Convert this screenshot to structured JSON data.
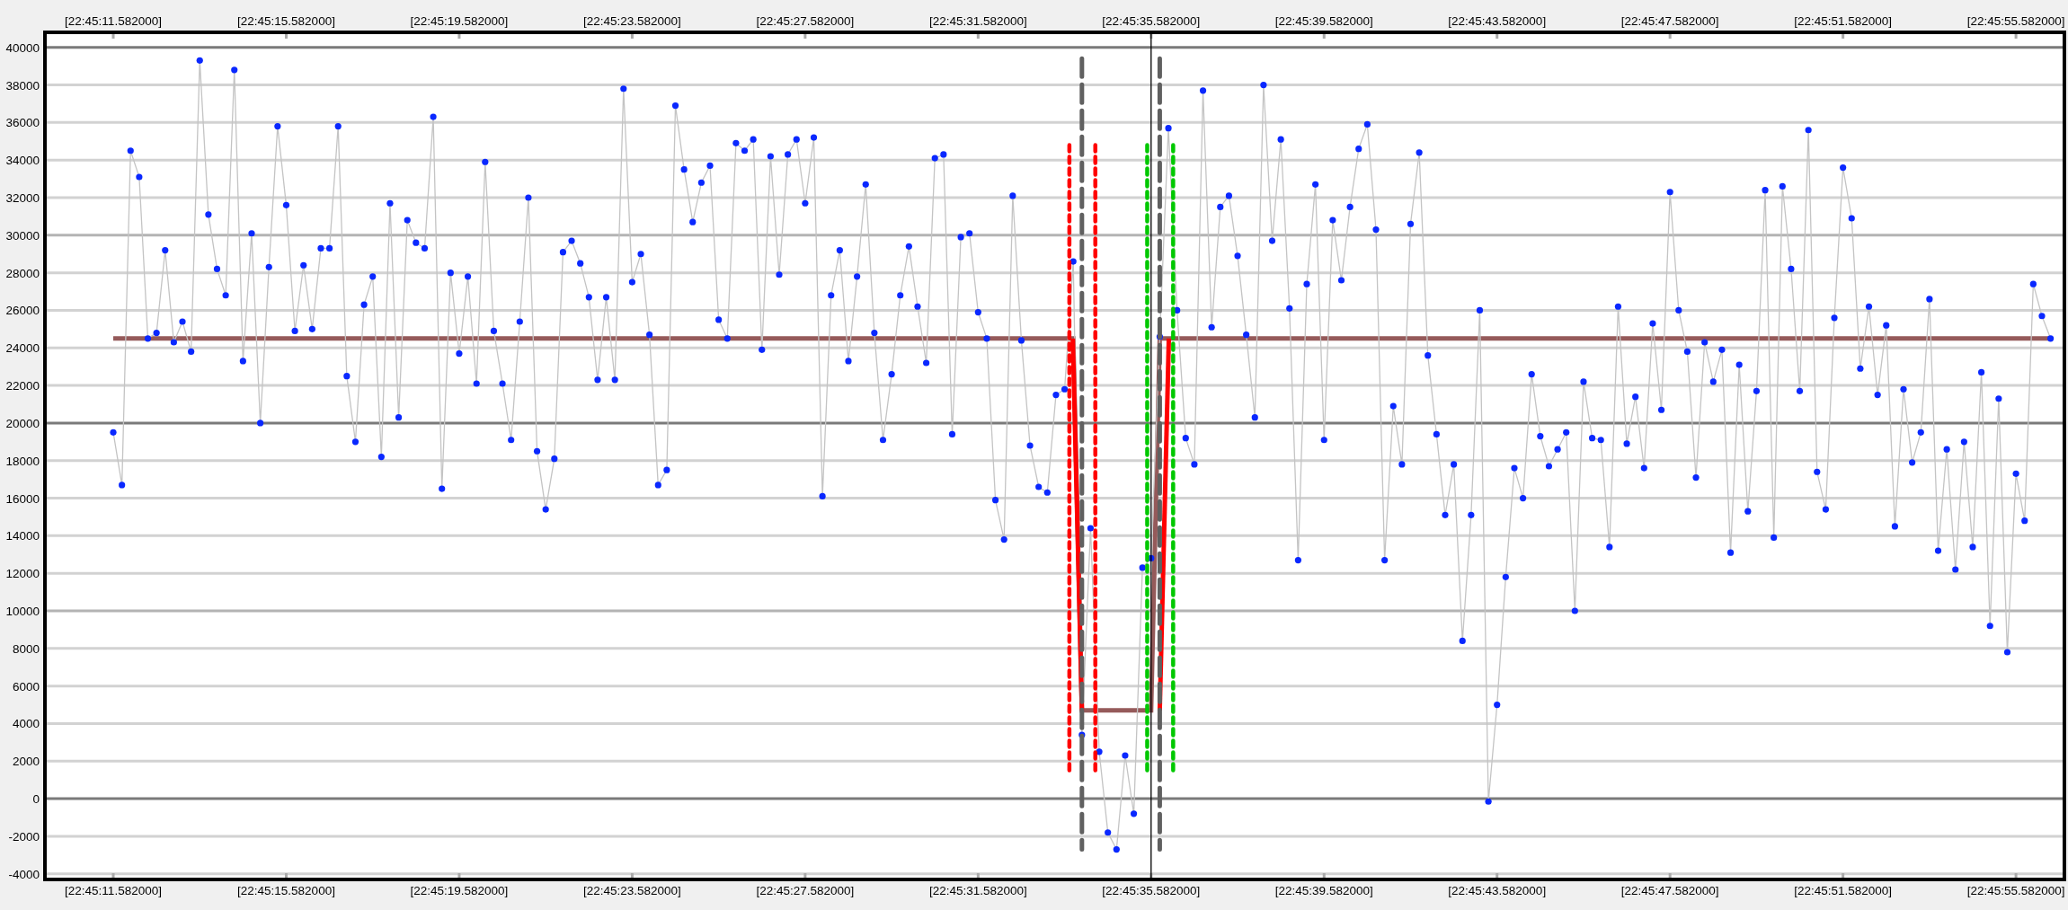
{
  "chart": {
    "chart_data": {
      "type": "line",
      "categories": [
        "[22:45:11.582000]",
        null,
        null,
        null,
        null,
        null,
        null,
        null,
        null,
        null,
        null,
        null,
        null,
        null,
        null,
        null,
        null,
        null,
        null,
        null,
        "[22:45:15.582000]",
        null,
        null,
        null,
        null,
        null,
        null,
        null,
        null,
        null,
        null,
        null,
        null,
        null,
        null,
        null,
        null,
        null,
        null,
        null,
        "[22:45:19.582000]",
        null,
        null,
        null,
        null,
        null,
        null,
        null,
        null,
        null,
        null,
        null,
        null,
        null,
        null,
        null,
        null,
        null,
        null,
        null,
        "[22:45:23.582000]",
        null,
        null,
        null,
        null,
        null,
        null,
        null,
        null,
        null,
        null,
        null,
        null,
        null,
        null,
        null,
        null,
        null,
        null,
        null,
        "[22:45:27.582000]",
        null,
        null,
        null,
        null,
        null,
        null,
        null,
        null,
        null,
        null,
        null,
        null,
        null,
        null,
        null,
        null,
        null,
        null,
        null,
        "[22:45:31.582000]",
        null,
        null,
        null,
        null,
        null,
        null,
        null,
        null,
        null,
        null,
        null,
        null,
        null,
        null,
        null,
        null,
        null,
        null,
        null,
        "[22:45:35.582000]",
        null,
        null,
        null,
        null,
        null,
        null,
        null,
        null,
        null,
        null,
        null,
        null,
        null,
        null,
        null,
        null,
        null,
        null,
        null,
        "[22:45:39.582000]",
        null,
        null,
        null,
        null,
        null,
        null,
        null,
        null,
        null,
        null,
        null,
        null,
        null,
        null,
        null,
        null,
        null,
        null,
        null,
        "[22:45:43.582000]",
        null,
        null,
        null,
        null,
        null,
        null,
        null,
        null,
        null,
        null,
        null,
        null,
        null,
        null,
        null,
        null,
        null,
        null,
        null,
        "[22:45:47.582000]",
        null,
        null,
        null,
        null,
        null,
        null,
        null,
        null,
        null,
        null,
        null,
        null,
        null,
        null,
        null,
        null,
        null,
        null,
        null,
        "[22:45:51.582000]",
        null,
        null,
        null,
        null,
        null,
        null,
        null,
        null,
        null,
        null,
        null,
        null,
        null,
        null,
        null,
        null,
        null,
        null,
        null,
        "[22:45:55.582000]",
        null,
        null,
        null,
        null
      ],
      "grid": true,
      "series": [
        {
          "color": "#0a28ff",
          "marker": "o",
          "values": [
            19500,
            16700,
            34500,
            33100,
            24500,
            24800,
            29200,
            24300,
            25400,
            23800,
            39300,
            31100,
            28200,
            26800,
            38800,
            23300,
            30100,
            20000,
            28300,
            35800,
            31600,
            24900,
            28400,
            25000,
            29300,
            29300,
            35800,
            22500,
            19000,
            26300,
            27800,
            18200,
            31700,
            20300,
            30800,
            29600,
            29300,
            36300,
            16500,
            28000,
            23700,
            27800,
            22100,
            33900,
            24900,
            22100,
            19100,
            25400,
            32000,
            18500,
            15400,
            18100,
            29100,
            29700,
            28500,
            26700,
            22300,
            26700,
            22300,
            37800,
            27500,
            29000,
            24700,
            16700,
            17500,
            36900,
            33500,
            30700,
            32800,
            33700,
            25500,
            24500,
            34900,
            34500,
            35100,
            23900,
            34200,
            27900,
            34300,
            35100,
            31700,
            35200,
            16100,
            26800,
            29200,
            23300,
            27800,
            32700,
            24800,
            19100,
            22600,
            26800,
            29400,
            26200,
            23200,
            34100,
            34300,
            19400,
            29900,
            30100,
            25900,
            24500,
            15900,
            13800,
            32100,
            24400,
            18800,
            16600,
            16300,
            21500,
            21800,
            28600,
            3400,
            14400,
            2500,
            -1800,
            -2700,
            2300,
            -800,
            12300,
            12800,
            24600,
            35700,
            26000,
            19200,
            17800,
            37700,
            25100,
            31500,
            32100,
            28900,
            24700,
            20300,
            38000,
            29700,
            35100,
            26100,
            12700,
            27400,
            32700,
            19100,
            30800,
            27600,
            31500,
            34600,
            35900,
            30300,
            12700,
            20900,
            17800,
            30600,
            34400,
            23600,
            19400,
            15100,
            17800,
            8400,
            15100,
            26000,
            -150,
            5000,
            11800,
            17600,
            16000,
            22600,
            19300,
            17700,
            18600,
            19500,
            10000,
            22200,
            19200,
            19100,
            13400,
            26200,
            18900,
            21400,
            17600,
            25300,
            20700,
            32300,
            26000,
            23800,
            17100,
            24300,
            22200,
            23900,
            13100,
            23100,
            15300,
            21700,
            32400,
            13900,
            32600,
            28200,
            21700,
            35600,
            17400,
            15400,
            25600,
            33600,
            30900,
            22900,
            26200,
            21500,
            25200,
            14500,
            21800,
            17900,
            19500,
            26600,
            13200,
            18600,
            12200,
            19000,
            13400,
            22700,
            9200,
            21300,
            7800,
            17300,
            14800,
            27400,
            25700,
            24500
          ]
        },
        {
          "color": "#955a5a",
          "values": [
            24500,
            24500,
            24500,
            24500,
            24500,
            24500,
            24500,
            24500,
            24500,
            24500,
            24500,
            24500,
            24500,
            24500,
            24500,
            24500,
            24500,
            24500,
            24500,
            24500,
            24500,
            24500,
            24500,
            24500,
            24500,
            24500,
            24500,
            24500,
            24500,
            24500,
            24500,
            24500,
            24500,
            24500,
            24500,
            24500,
            24500,
            24500,
            24500,
            24500,
            24500,
            24500,
            24500,
            24500,
            24500,
            24500,
            24500,
            24500,
            24500,
            24500,
            24500,
            24500,
            24500,
            24500,
            24500,
            24500,
            24500,
            24500,
            24500,
            24500,
            24500,
            24500,
            24500,
            24500,
            24500,
            24500,
            24500,
            24500,
            24500,
            24500,
            24500,
            24500,
            24500,
            24500,
            24500,
            24500,
            24500,
            24500,
            24500,
            24500,
            24500,
            24500,
            24500,
            24500,
            24500,
            24500,
            24500,
            24500,
            24500,
            24500,
            24500,
            24500,
            24500,
            24500,
            24500,
            24500,
            24500,
            24500,
            24500,
            24500,
            24500,
            24500,
            24500,
            24500,
            24500,
            24500,
            24500,
            24500,
            24500,
            24500,
            24500,
            24500,
            4700,
            4700,
            4700,
            4700,
            4700,
            4700,
            4700,
            4700,
            4700,
            24500,
            24500,
            24500,
            24500,
            24500,
            24500,
            24500,
            24500,
            24500,
            24500,
            24500,
            24500,
            24500,
            24500,
            24500,
            24500,
            24500,
            24500,
            24500,
            24500,
            24500,
            24500,
            24500,
            24500,
            24500,
            24500,
            24500,
            24500,
            24500,
            24500,
            24500,
            24500,
            24500,
            24500,
            24500,
            24500,
            24500,
            24500,
            24500,
            24500,
            24500,
            24500,
            24500,
            24500,
            24500,
            24500,
            24500,
            24500,
            24500,
            24500,
            24500,
            24500,
            24500,
            24500,
            24500,
            24500,
            24500,
            24500,
            24500,
            24500,
            24500,
            24500,
            24500,
            24500,
            24500,
            24500,
            24500,
            24500,
            24500,
            24500,
            24500,
            24500,
            24500,
            24500,
            24500,
            24500,
            24500,
            24500,
            24500,
            24500,
            24500,
            24500,
            24500,
            24500,
            24500,
            24500,
            24500,
            24500,
            24500,
            24500,
            24500,
            24500,
            24500,
            24500,
            24500,
            24500,
            24500,
            24500,
            24500,
            24500,
            24500,
            24500,
            24500,
            24500
          ]
        }
      ],
      "ylim": [
        -4300,
        40800
      ],
      "yticks": [
        -4000,
        -2000,
        0,
        2000,
        4000,
        6000,
        8000,
        10000,
        12000,
        14000,
        16000,
        18000,
        20000,
        22000,
        24000,
        26000,
        28000,
        30000,
        32000,
        34000,
        36000,
        38000,
        40000
      ]
    }
  }
}
